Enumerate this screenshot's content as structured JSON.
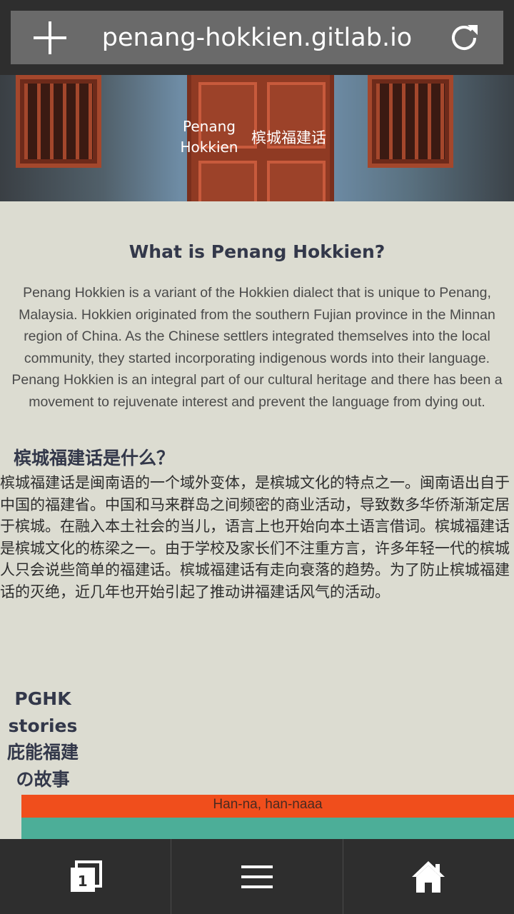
{
  "browser": {
    "url": "penang-hokkien.gitlab.io",
    "tab_count": "1"
  },
  "hero": {
    "logo_en": "Penang Hokkien",
    "logo_zh": "槟城福建话"
  },
  "about_en": {
    "title": "What is Penang Hokkien?",
    "body": "Penang Hokkien is a variant of the Hokkien dialect that is unique to Penang, Malaysia. Hokkien originated from the southern Fujian province in the Minnan region of China. As the Chinese settlers integrated themselves into the local community, they started incorporating indigenous words into their language. Penang Hokkien is an integral part of our cultural heritage and there has been a movement to rejuvenate interest and prevent the language from dying out."
  },
  "about_zh": {
    "title": "槟城福建话是什么？",
    "body": "槟城福建话是闽南语的一个域外变体，是槟城文化的特点之一。闽南语出自于中国的福建省。中国和马来群岛之间频密的商业活动，导致数多华侨渐渐定居于槟城。在融入本土社会的当儿，语言上也开始向本土语言借词。槟城福建话是槟城文化的栋梁之一。由于学校及家长们不注重方言，许多年轻一代的槟城人只会说些简单的福建话。槟城福建话有走向衰落的趋势。为了防止槟城福建话的灭绝，近几年也开始引起了推动讲福建话风气的活动。"
  },
  "stories": {
    "line1": "PGHK",
    "line2": "stories",
    "line3": "庇能福建",
    "line4": "の故事"
  },
  "banner": {
    "text": "Han-na, han-naaa"
  },
  "colors": {
    "orange": "#f04e1c",
    "teal": "#4cae98",
    "chrome": "#2e2e2e"
  },
  "icons": [
    "plus-icon",
    "reload-icon",
    "tabs-icon",
    "menu-icon",
    "home-icon"
  ]
}
